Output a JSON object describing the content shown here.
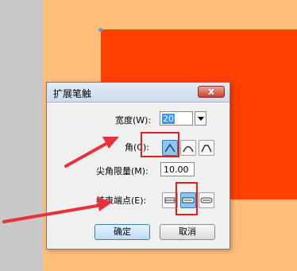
{
  "dialog": {
    "title": "扩展笔触",
    "close_label": "x",
    "width_label": "宽度(W):",
    "width_value": "20",
    "corner_label": "角(C):",
    "miter_label": "尖角限量(M):",
    "miter_value": "10.00",
    "end_label": "结束端点(E):",
    "ok_label": "确定",
    "cancel_label": "取消"
  },
  "colors": {
    "canvas": "#ffbf7a",
    "shape": "#ff4000",
    "panel": "#c8c8c8",
    "highlight": "#e21f1f"
  },
  "icons": {
    "corners": [
      "corner-miter-icon",
      "corner-round-icon",
      "corner-bevel-icon"
    ],
    "ends": [
      "end-butt-icon",
      "end-square-icon",
      "end-round-icon"
    ]
  }
}
